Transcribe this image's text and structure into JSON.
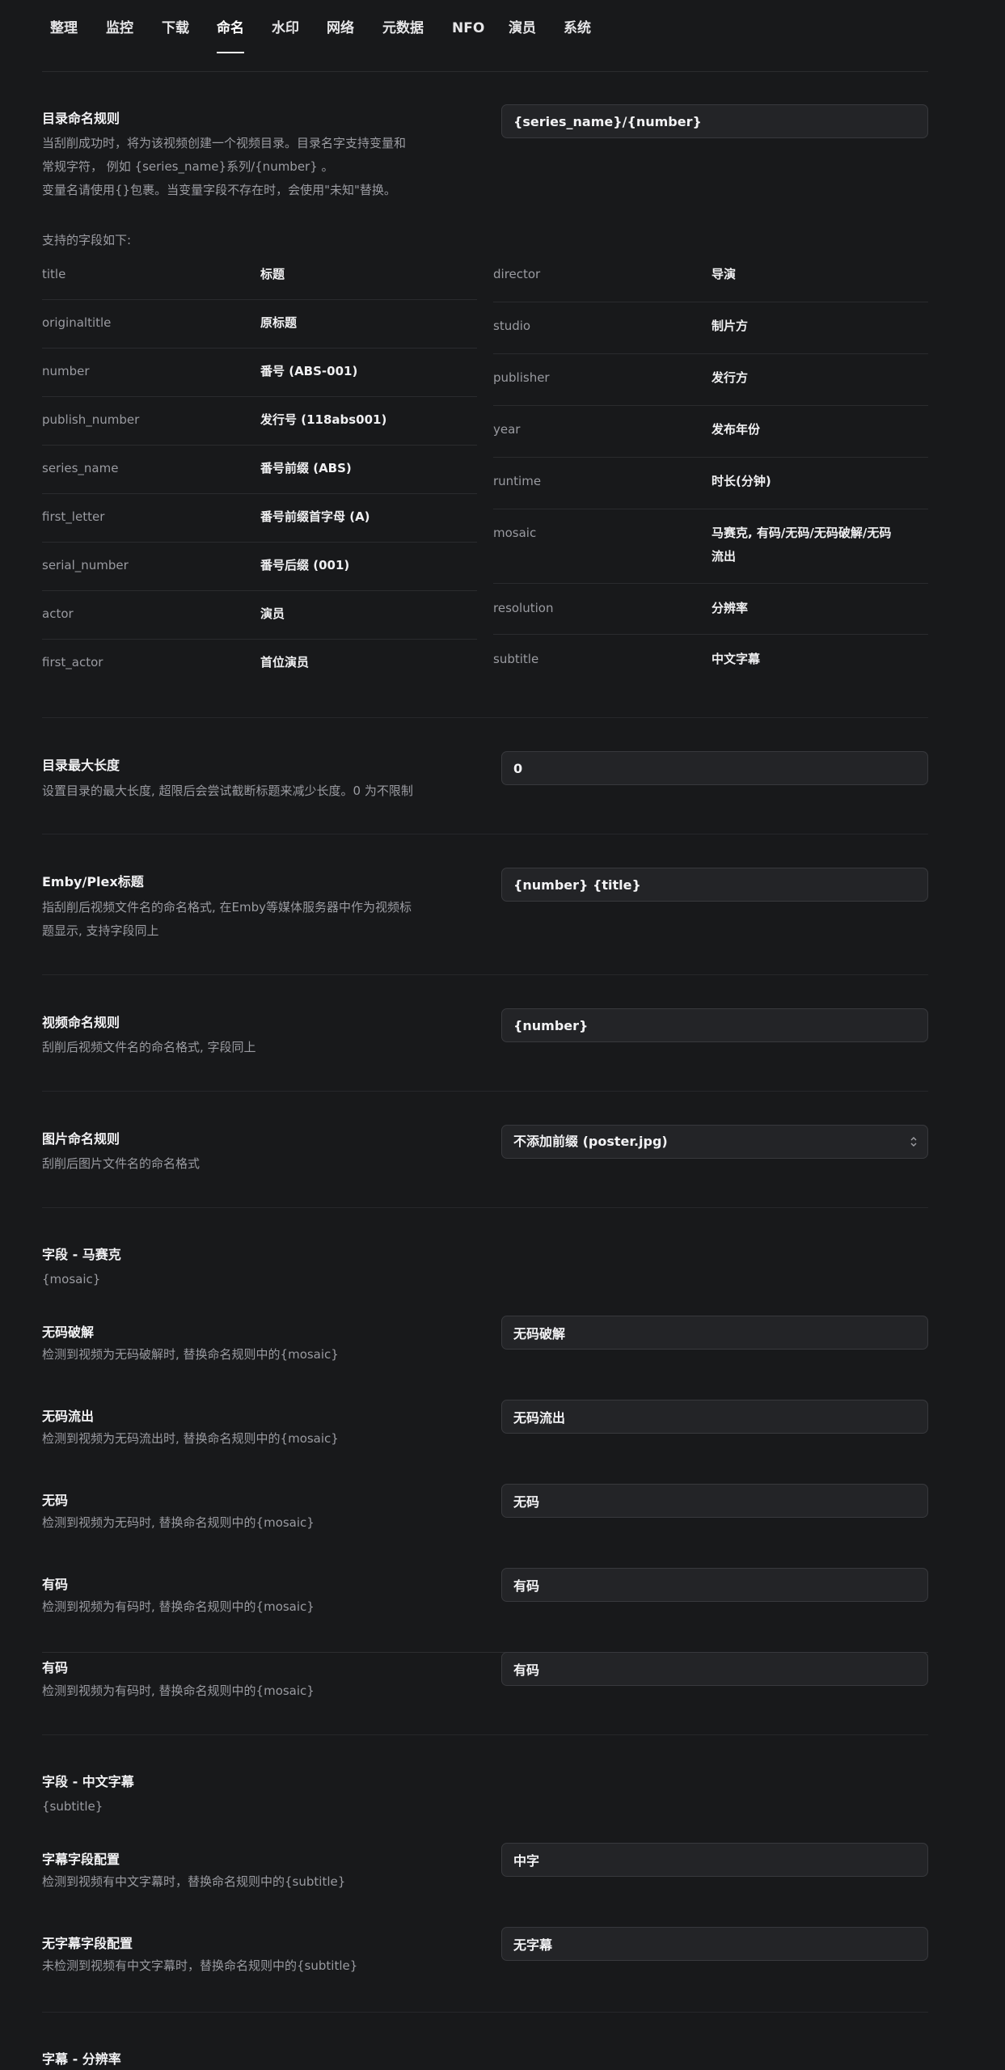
{
  "tabs": [
    {
      "label": "整理"
    },
    {
      "label": "监控"
    },
    {
      "label": "下载"
    },
    {
      "label": "命名"
    },
    {
      "label": "水印"
    },
    {
      "label": "网络"
    },
    {
      "label": "元数据"
    },
    {
      "label": "NFO"
    },
    {
      "label": "演员"
    },
    {
      "label": "系统"
    }
  ],
  "active_tab": "命名",
  "dir_rule": {
    "title": "目录命名规则",
    "desc_line1": "当刮削成功时，将为该视频创建一个视频目录。目录名字支持变量和",
    "desc_line2": "常规字符， 例如 {series_name}系列/{number} 。",
    "desc_line3": "变量名请使用{}包裹。当变量字段不存在时，会使用\"未知\"替换。",
    "value": "{series_name}/{number}",
    "fields_heading": "支持的字段如下:",
    "fields_left": [
      {
        "name": "title",
        "desc": "标题"
      },
      {
        "name": "originaltitle",
        "desc": "原标题"
      },
      {
        "name": "number",
        "desc": "番号 (ABS-001)"
      },
      {
        "name": "publish_number",
        "desc": "发行号 (118abs001)"
      },
      {
        "name": "series_name",
        "desc": "番号前缀 (ABS)"
      },
      {
        "name": "first_letter",
        "desc": "番号前缀首字母 (A)"
      },
      {
        "name": "serial_number",
        "desc": "番号后缀 (001)"
      },
      {
        "name": "actor",
        "desc": "演员"
      },
      {
        "name": "first_actor",
        "desc": "首位演员"
      }
    ],
    "fields_right": [
      {
        "name": "director",
        "desc": "导演"
      },
      {
        "name": "studio",
        "desc": "制片方"
      },
      {
        "name": "publisher",
        "desc": "发行方"
      },
      {
        "name": "year",
        "desc": "发布年份"
      },
      {
        "name": "runtime",
        "desc": "时长(分钟)"
      },
      {
        "name": "mosaic",
        "desc": "马赛克, 有码/无码/无码破解/无码",
        "desc2": "流出"
      },
      {
        "name": "resolution",
        "desc": "分辨率"
      },
      {
        "name": "subtitle",
        "desc": "中文字幕"
      }
    ]
  },
  "dir_max_len": {
    "title": "目录最大长度",
    "desc": "设置目录的最大长度, 超限后会尝试截断标题来减少长度。0 为不限制",
    "value": "0"
  },
  "emby_title": {
    "title": "Emby/Plex标题",
    "desc_line1": "指刮削后视频文件名的命名格式, 在Emby等媒体服务器中作为视频标",
    "desc_line2": "题显示, 支持字段同上",
    "value": "{number} {title}"
  },
  "video_rule": {
    "title": "视频命名规则",
    "desc": "刮削后视频文件名的命名格式, 字段同上",
    "value": "{number}"
  },
  "image_rule": {
    "title": "图片命名规则",
    "desc": "刮削后图片文件名的命名格式",
    "value": "不添加前缀 (poster.jpg)"
  },
  "mosaic_section": {
    "title": "字段 - 马赛克",
    "var": "{mosaic}",
    "items": [
      {
        "title": "无码破解",
        "desc": "检测到视频为无码破解时, 替换命名规则中的{mosaic}",
        "value": "无码破解"
      },
      {
        "title": "无码流出",
        "desc": "检测到视频为无码流出时, 替换命名规则中的{mosaic}",
        "value": "无码流出"
      },
      {
        "title": "无码",
        "desc": "检测到视频为无码时, 替换命名规则中的{mosaic}",
        "value": "无码"
      },
      {
        "title": "有码",
        "desc": "检测到视频为有码时, 替换命名规则中的{mosaic}",
        "value": "有码"
      },
      {
        "title": "有码",
        "desc": "检测到视频为有码时, 替换命名规则中的{mosaic}",
        "value": "有码"
      }
    ]
  },
  "subtitle_section": {
    "title": "字段 - 中文字幕",
    "var": "{subtitle}",
    "items": [
      {
        "title": "字幕字段配置",
        "desc": "检测到视频有中文字幕时，替换命名规则中的{subtitle}",
        "value": "中字"
      },
      {
        "title": "无字幕字段配置",
        "desc": "未检测到视频有中文字幕时，替换命名规则中的{subtitle}",
        "value": "无字幕"
      }
    ]
  },
  "resolution_section": {
    "title": "字幕 - 分辨率"
  }
}
